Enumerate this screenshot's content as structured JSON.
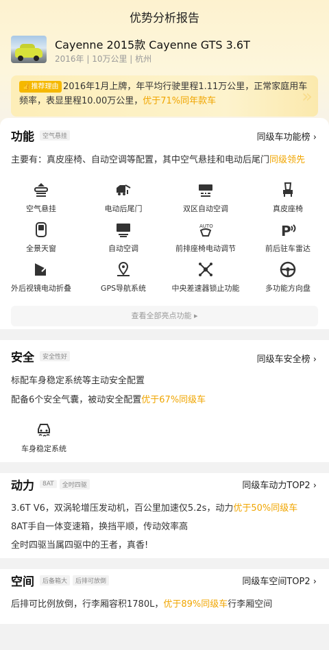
{
  "page": {
    "title": "优势分析报告"
  },
  "car": {
    "name": "Cayenne 2015款 Cayenne GTS 3.6T",
    "sub": "2016年 | 10万公里 | 杭州",
    "reason_tag": "推荐理由",
    "reason_text": "2016年1月上牌，年平均行驶里程1.11万公里，正常家庭用车频率，表显里程10.00万公里，",
    "reason_highlight": "优于71%同年款车"
  },
  "function": {
    "title": "功能",
    "tag": "空气悬挂",
    "link": "同级车功能榜",
    "summary": "主要有：真皮座椅、自动空调等配置，其中空气悬挂和电动后尾门",
    "summary_highlight": "同级领先",
    "features": [
      {
        "label": "空气悬挂",
        "icon": "air-suspension-icon"
      },
      {
        "label": "电动后尾门",
        "icon": "power-tailgate-icon"
      },
      {
        "label": "双区自动空调",
        "icon": "dual-zone-ac-icon"
      },
      {
        "label": "真皮座椅",
        "icon": "leather-seat-icon"
      },
      {
        "label": "全景天窗",
        "icon": "panoramic-sunroof-icon"
      },
      {
        "label": "自动空调",
        "icon": "auto-ac-icon"
      },
      {
        "label": "前排座椅电动调节",
        "icon": "power-seat-icon"
      },
      {
        "label": "前后驻车雷达",
        "icon": "parking-radar-icon"
      },
      {
        "label": "外后视镜电动折叠",
        "icon": "folding-mirror-icon"
      },
      {
        "label": "GPS导航系统",
        "icon": "gps-icon"
      },
      {
        "label": "中央差速器锁止功能",
        "icon": "diff-lock-icon"
      },
      {
        "label": "多功能方向盘",
        "icon": "steering-wheel-icon"
      }
    ],
    "view_all": "查看全部亮点功能 ▸"
  },
  "safety": {
    "title": "安全",
    "tag": "安全性好",
    "link": "同级车安全榜",
    "line1": "标配车身稳定系统等主动安全配置",
    "line2": "配备6个安全气囊，被动安全配置",
    "line2_highlight": "优于67%同级车",
    "feature": "车身稳定系统"
  },
  "power": {
    "title": "动力",
    "tags": [
      "8AT",
      "全时四驱"
    ],
    "link": "同级车动力TOP2",
    "line1": "3.6T V6，双涡轮增压发动机，百公里加速仅5.2s，动力",
    "line1_highlight": "优于50%同级车",
    "line2": "8AT手自一体变速箱，换挡平顺，传动效率高",
    "line3": "全时四驱当属四驱中的王者，真香!"
  },
  "space": {
    "title": "空间",
    "tags": [
      "后备箱大",
      "后排可放倒"
    ],
    "link": "同级车空间TOP2",
    "line1": "后排可比例放倒，行李厢容积1780L，",
    "line1_highlight": "优于89%同级车",
    "line1_tail": "行李厢空间"
  },
  "colors": {
    "highlight": "#f0a500",
    "tag_bg": "#f5b800"
  }
}
